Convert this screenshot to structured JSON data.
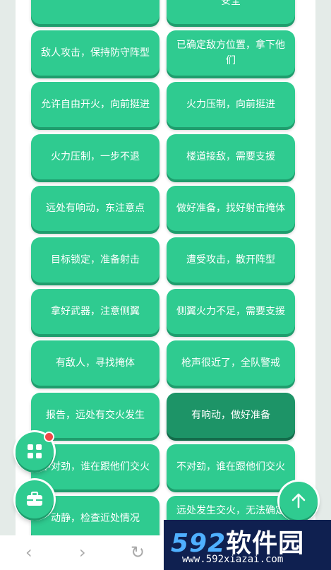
{
  "phrases": [
    "",
    "安全",
    "敌人攻击，保持防守阵型",
    "已确定敌方位置，拿下他们",
    "允许自由开火，向前挺进",
    "火力压制，向前挺进",
    "火力压制，一步不退",
    "楼道接敌，需要支援",
    "远处有响动，东注意点",
    "做好准备，找好射击掩体",
    "目标锁定，准备射击",
    "遭受攻击，散开阵型",
    "拿好武器，注意侧翼",
    "侧翼火力不足，需要支援",
    "有敌人，寻找掩体",
    "枪声很近了，全队警戒",
    "报告，远处有交火发生",
    "有响动，做好准备",
    "不对劲，谁在跟他们交火",
    "不对劲，谁在跟他们交火",
    "动静，检查近处情况",
    "远处发生交火，无法确定具体方位"
  ],
  "active_phrase": "有响动，做好准备",
  "fab": {
    "menu_icon": "grid-icon",
    "toolbox_icon": "toolbox-icon",
    "up_icon": "arrow-up-icon"
  },
  "nav": {
    "back": "‹",
    "forward": "›",
    "refresh": "↻"
  },
  "watermark": {
    "num": "592",
    "text": "软件园",
    "url": "www.592xiazai.com"
  },
  "colors": {
    "accent": "#2fcb90",
    "accent_dark": "#1d9467",
    "badge": "#f04848"
  }
}
